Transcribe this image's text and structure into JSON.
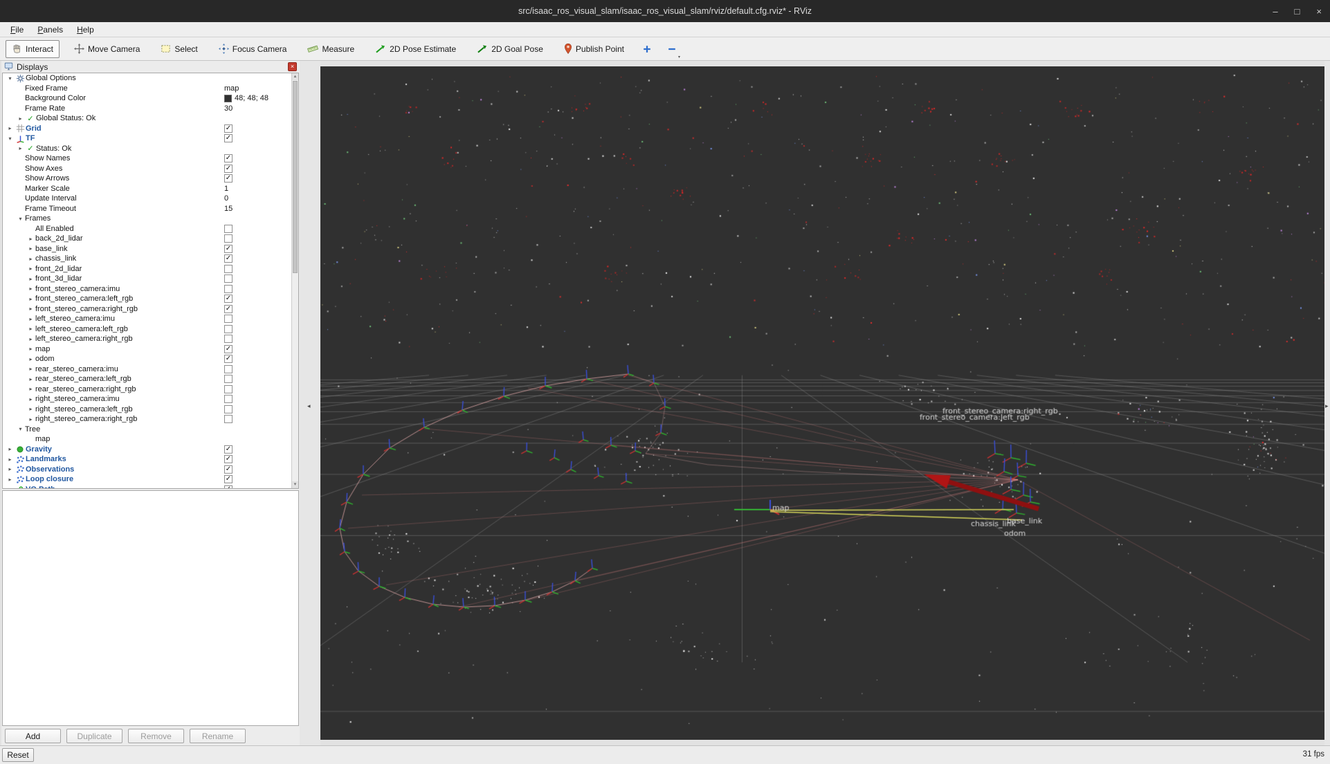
{
  "window": {
    "title": "src/isaac_ros_visual_slam/isaac_ros_visual_slam/rviz/default.cfg.rviz* - RViz",
    "controls": [
      {
        "name": "minimize",
        "glyph": "–"
      },
      {
        "name": "maximize",
        "glyph": "□"
      },
      {
        "name": "close",
        "glyph": "×"
      }
    ]
  },
  "menu": {
    "items": [
      {
        "label": "File"
      },
      {
        "label": "Panels"
      },
      {
        "label": "Help"
      }
    ]
  },
  "toolbar": {
    "tools": [
      {
        "label": "Interact",
        "icon": "hand-icon",
        "active": true
      },
      {
        "label": "Move Camera",
        "icon": "move-camera-icon",
        "active": false
      },
      {
        "label": "Select",
        "icon": "select-box-icon",
        "active": false
      },
      {
        "label": "Focus Camera",
        "icon": "focus-camera-icon",
        "active": false
      },
      {
        "label": "Measure",
        "icon": "measure-ruler-icon",
        "active": false
      },
      {
        "label": "2D Pose Estimate",
        "icon": "pose-arrow-icon",
        "active": false
      },
      {
        "label": "2D Goal Pose",
        "icon": "goal-arrow-icon",
        "active": false
      },
      {
        "label": "Publish Point",
        "icon": "publish-point-pin-icon",
        "active": false
      }
    ],
    "extra": [
      {
        "name": "add-tool",
        "icon": "plus-icon",
        "dropdown": false
      },
      {
        "name": "remove-tool",
        "icon": "minus-icon",
        "dropdown": true
      }
    ]
  },
  "displays_panel": {
    "title": "Displays",
    "tree": [
      {
        "indent": 0,
        "expander": "open",
        "icon": "options-icon",
        "label": "Global Options"
      },
      {
        "indent": 1,
        "expander": "none",
        "label": "Fixed Frame",
        "value": "map"
      },
      {
        "indent": 1,
        "expander": "none",
        "label": "Background Color",
        "value": "48; 48; 48",
        "swatch": "#303030"
      },
      {
        "indent": 1,
        "expander": "none",
        "label": "Frame Rate",
        "value": "30"
      },
      {
        "indent": 1,
        "expander": "closed",
        "icon": "check-icon",
        "label": "Global Status: Ok"
      },
      {
        "indent": 0,
        "expander": "closed",
        "icon": "grid-icon",
        "label": "Grid",
        "bold": true,
        "check": true
      },
      {
        "indent": 0,
        "expander": "open",
        "icon": "tf-icon",
        "label": "TF",
        "bold": true,
        "check": true
      },
      {
        "indent": 1,
        "expander": "closed",
        "icon": "check-icon",
        "label": "Status: Ok"
      },
      {
        "indent": 1,
        "expander": "none",
        "label": "Show Names",
        "check": true
      },
      {
        "indent": 1,
        "expander": "none",
        "label": "Show Axes",
        "check": true
      },
      {
        "indent": 1,
        "expander": "none",
        "label": "Show Arrows",
        "check": true
      },
      {
        "indent": 1,
        "expander": "none",
        "label": "Marker Scale",
        "value": "1"
      },
      {
        "indent": 1,
        "expander": "none",
        "label": "Update Interval",
        "value": "0"
      },
      {
        "indent": 1,
        "expander": "none",
        "label": "Frame Timeout",
        "value": "15"
      },
      {
        "indent": 1,
        "expander": "open",
        "label": "Frames"
      },
      {
        "indent": 2,
        "expander": "none",
        "label": "All Enabled",
        "check": false
      },
      {
        "indent": 2,
        "expander": "closed",
        "label": "back_2d_lidar",
        "check": false
      },
      {
        "indent": 2,
        "expander": "closed",
        "label": "base_link",
        "check": true
      },
      {
        "indent": 2,
        "expander": "closed",
        "label": "chassis_link",
        "check": true
      },
      {
        "indent": 2,
        "expander": "closed",
        "label": "front_2d_lidar",
        "check": false
      },
      {
        "indent": 2,
        "expander": "closed",
        "label": "front_3d_lidar",
        "check": false
      },
      {
        "indent": 2,
        "expander": "closed",
        "label": "front_stereo_camera:imu",
        "check": false
      },
      {
        "indent": 2,
        "expander": "closed",
        "label": "front_stereo_camera:left_rgb",
        "check": true
      },
      {
        "indent": 2,
        "expander": "closed",
        "label": "front_stereo_camera:right_rgb",
        "check": true
      },
      {
        "indent": 2,
        "expander": "closed",
        "label": "left_stereo_camera:imu",
        "check": false
      },
      {
        "indent": 2,
        "expander": "closed",
        "label": "left_stereo_camera:left_rgb",
        "check": false
      },
      {
        "indent": 2,
        "expander": "closed",
        "label": "left_stereo_camera:right_rgb",
        "check": false
      },
      {
        "indent": 2,
        "expander": "closed",
        "label": "map",
        "check": true
      },
      {
        "indent": 2,
        "expander": "closed",
        "label": "odom",
        "check": true
      },
      {
        "indent": 2,
        "expander": "closed",
        "label": "rear_stereo_camera:imu",
        "check": false
      },
      {
        "indent": 2,
        "expander": "closed",
        "label": "rear_stereo_camera:left_rgb",
        "check": false
      },
      {
        "indent": 2,
        "expander": "closed",
        "label": "rear_stereo_camera:right_rgb",
        "check": false
      },
      {
        "indent": 2,
        "expander": "closed",
        "label": "right_stereo_camera:imu",
        "check": false
      },
      {
        "indent": 2,
        "expander": "closed",
        "label": "right_stereo_camera:left_rgb",
        "check": false
      },
      {
        "indent": 2,
        "expander": "closed",
        "label": "right_stereo_camera:right_rgb",
        "check": false
      },
      {
        "indent": 1,
        "expander": "open",
        "label": "Tree"
      },
      {
        "indent": 2,
        "expander": "none",
        "label": "map"
      },
      {
        "indent": 0,
        "expander": "closed",
        "icon": "gravity-icon",
        "label": "Gravity",
        "bold": true,
        "check": true
      },
      {
        "indent": 0,
        "expander": "closed",
        "icon": "points-icon",
        "label": "Landmarks",
        "bold": true,
        "check": true
      },
      {
        "indent": 0,
        "expander": "closed",
        "icon": "points-icon",
        "label": "Observations",
        "bold": true,
        "check": true
      },
      {
        "indent": 0,
        "expander": "closed",
        "icon": "points-icon",
        "label": "Loop closure",
        "bold": true,
        "check": true
      },
      {
        "indent": 0,
        "expander": "closed",
        "icon": "path-icon",
        "label": "VO Path",
        "bold": true,
        "check": true
      }
    ],
    "buttons": [
      {
        "label": "Add",
        "enabled": true
      },
      {
        "label": "Duplicate",
        "enabled": false
      },
      {
        "label": "Remove",
        "enabled": false
      },
      {
        "label": "Rename",
        "enabled": false
      }
    ]
  },
  "status_bar": {
    "reset_label": "Reset",
    "fps": "31 fps"
  },
  "viewport": {
    "background": "#303030",
    "labels": [
      "map",
      "odom",
      "base_link",
      "chassis_link",
      "front_stereo_camera:left_rgb",
      "front_stereo_camera:right_rgb"
    ],
    "colors": {
      "grid": "#8c8c8c",
      "path": "#e8a8a8",
      "axis_x": "#cc3333",
      "axis_y": "#2faf2f",
      "axis_z": "#3a4fd8",
      "arrow": "#b01515",
      "link_line": "#d6d65a"
    }
  }
}
